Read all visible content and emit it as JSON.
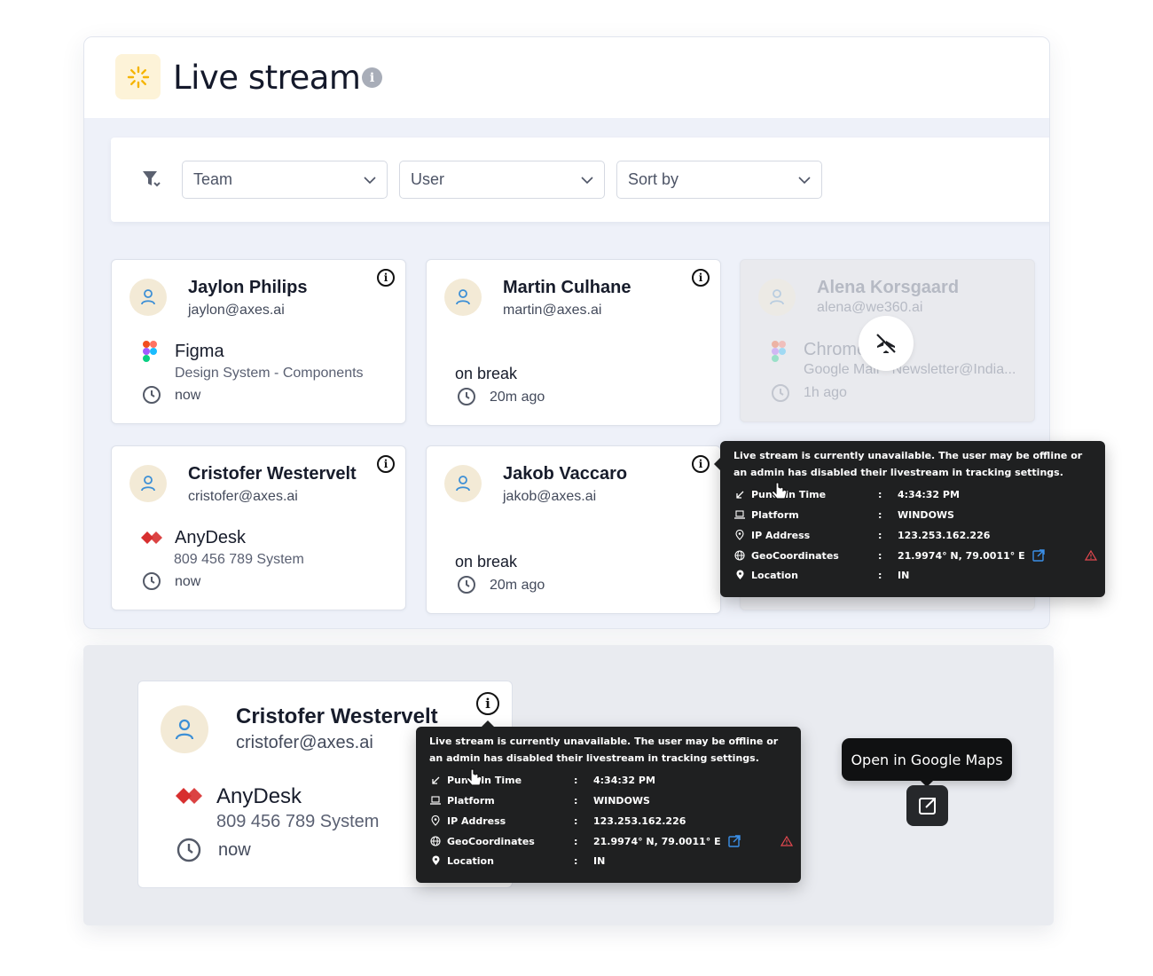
{
  "header": {
    "title": "Live stream",
    "info_glyph": "i"
  },
  "filters": {
    "team": {
      "value": "Team"
    },
    "user": {
      "value": "User"
    },
    "sort": {
      "value": "Sort by"
    }
  },
  "cards": [
    {
      "name": "Jaylon Philips",
      "email": "jaylon@axes.ai",
      "app": "Figma",
      "app_icon": "figma-icon",
      "detail": "Design System - Components",
      "time": "now"
    },
    {
      "name": "Martin Culhane",
      "email": "martin@axes.ai",
      "status": "on break",
      "time": "20m ago"
    },
    {
      "name": "Alena Korsgaard",
      "email": "alena@we360.ai",
      "app": "Chrome",
      "app_icon": "figma-icon",
      "detail": "Google Mail - Newsletter@India...",
      "time": "1h ago",
      "state": "livestream-unavailable"
    },
    {
      "name": "Cristofer Westervelt",
      "email": "cristofer@axes.ai",
      "app": "AnyDesk",
      "app_icon": "anydesk-icon",
      "detail": "809 456 789 System",
      "time": "now"
    },
    {
      "name": "Jakob Vaccaro",
      "email": "jakob@axes.ai",
      "status": "on break",
      "time": "20m ago"
    }
  ],
  "tooltip": {
    "message": "Live stream is currently unavailable. The user may be offline or an admin has disabled their livestream in tracking settings.",
    "rows": [
      {
        "icon": "punch-in-icon",
        "label": "PunchIn Time",
        "value": "4:34:32 PM"
      },
      {
        "icon": "laptop-icon",
        "label": "Platform",
        "value": "WINDOWS"
      },
      {
        "icon": "pin-outline-icon",
        "label": "IP Address",
        "value": "123.253.162.226"
      },
      {
        "icon": "globe-icon",
        "label": "GeoCoordinates",
        "value": "21.9974° N, 79.0011° E"
      },
      {
        "icon": "pin-filled-icon",
        "label": "Location",
        "value": "IN"
      }
    ],
    "separator": ":"
  },
  "zoom": {
    "card": {
      "name": "Cristofer Westervelt",
      "email": "cristofer@axes.ai",
      "app": "AnyDesk",
      "detail": "809 456 789 System",
      "time": "now"
    },
    "maps_tooltip": "Open in Google Maps"
  },
  "colors": {
    "accent": "#f5b400",
    "avatar_bg": "#f3ead6",
    "link_blue": "#3b8fe8",
    "warn_red": "#e4484f",
    "anydesk_red": "#d72f2f"
  }
}
